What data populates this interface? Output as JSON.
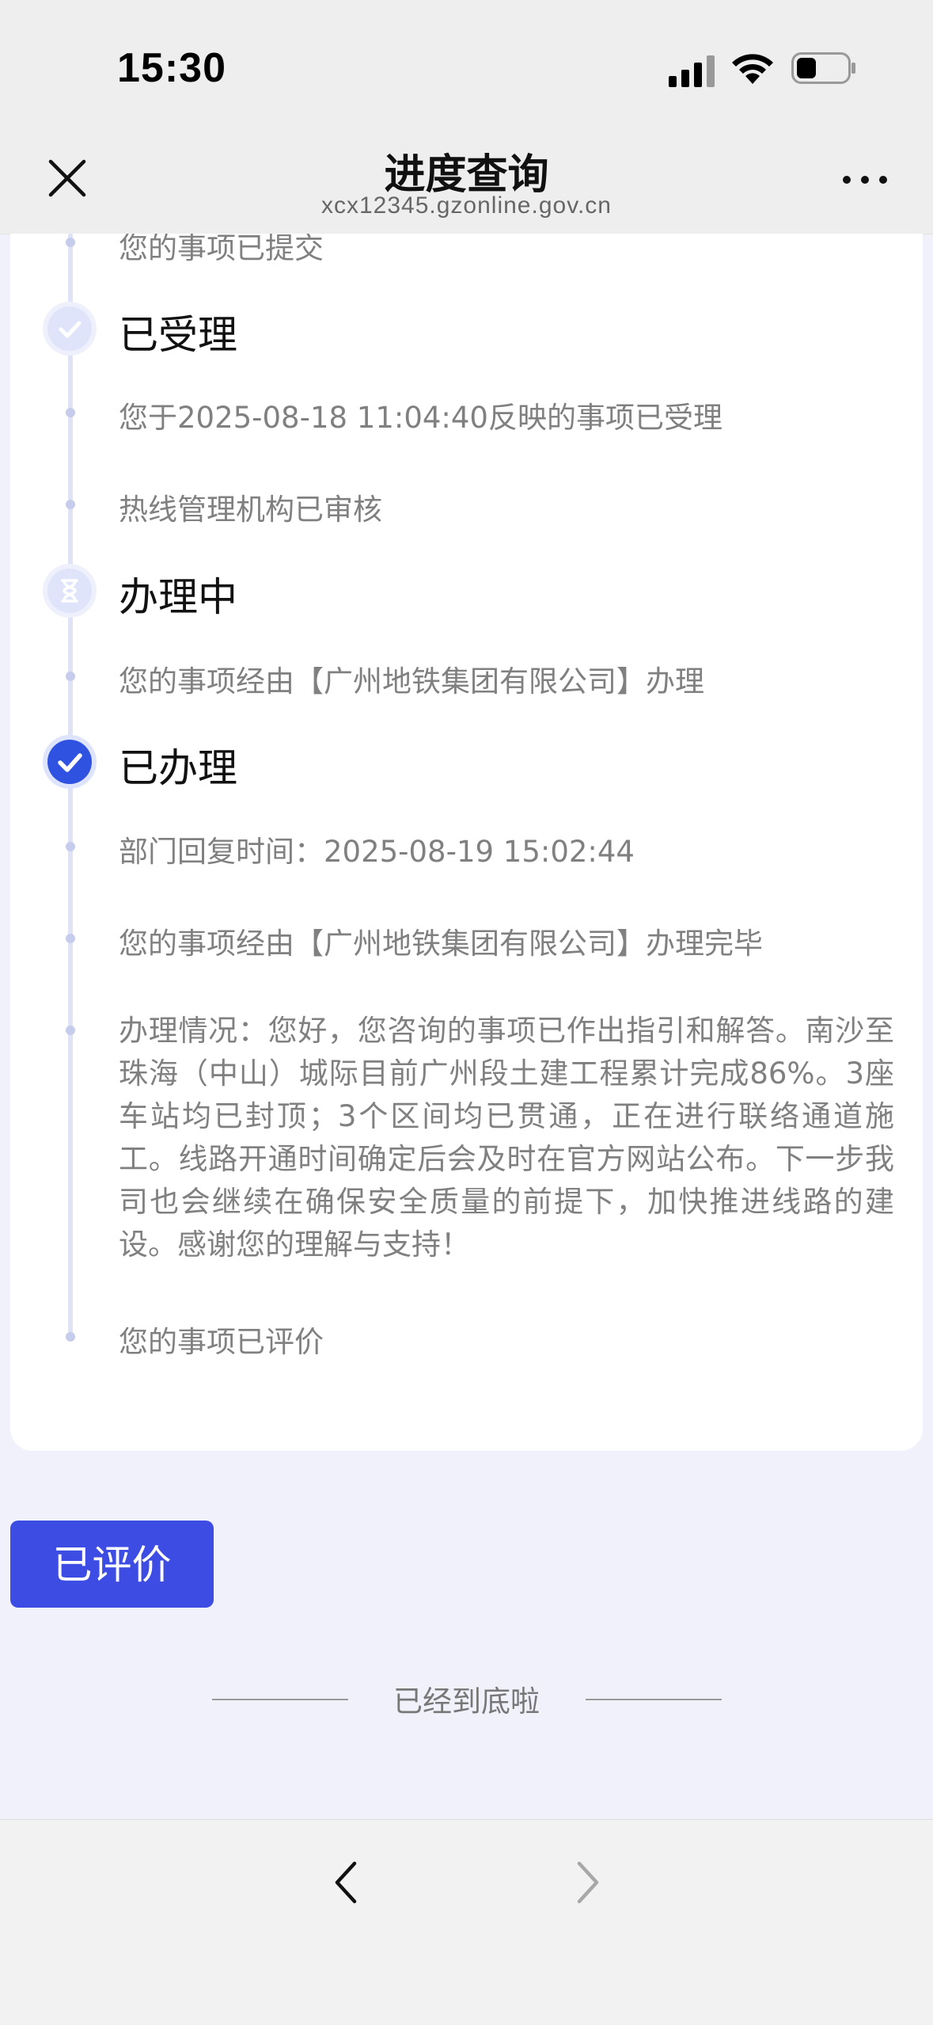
{
  "status_bar": {
    "time": "15:30"
  },
  "nav": {
    "title": "进度查询",
    "subtitle": "xcx12345.gzonline.gov.cn"
  },
  "timeline": {
    "submitted_partial": "您的事项已提交",
    "accepted": {
      "title": "已受理",
      "items": [
        "您于2025-08-18 11:04:40反映的事项已受理",
        "热线管理机构已审核"
      ]
    },
    "processing": {
      "title": "办理中",
      "items": [
        "您的事项经由【广州地铁集团有限公司】办理"
      ]
    },
    "done": {
      "title": "已办理",
      "items": [
        "部门回复时间：2025-08-19 15:02:44",
        "您的事项经由【广州地铁集团有限公司】办理完毕",
        "办理情况：您好，您咨询的事项已作出指引和解答。南沙至珠海（中山）城际目前广州段土建工程累计完成86%。3座车站均已封顶；3个区间均已贯通，正在进行联络通道施工。线路开通时间确定后会及时在官方网站公布。下一步我司也会继续在确保安全质量的前提下，加快推进线路的建设。感谢您的理解与支持！",
        "您的事项已评价"
      ]
    }
  },
  "rated_button": "已评价",
  "end_text": "已经到底啦",
  "colors": {
    "accent": "#3d4de3",
    "timeline": "#dfe3f5"
  }
}
